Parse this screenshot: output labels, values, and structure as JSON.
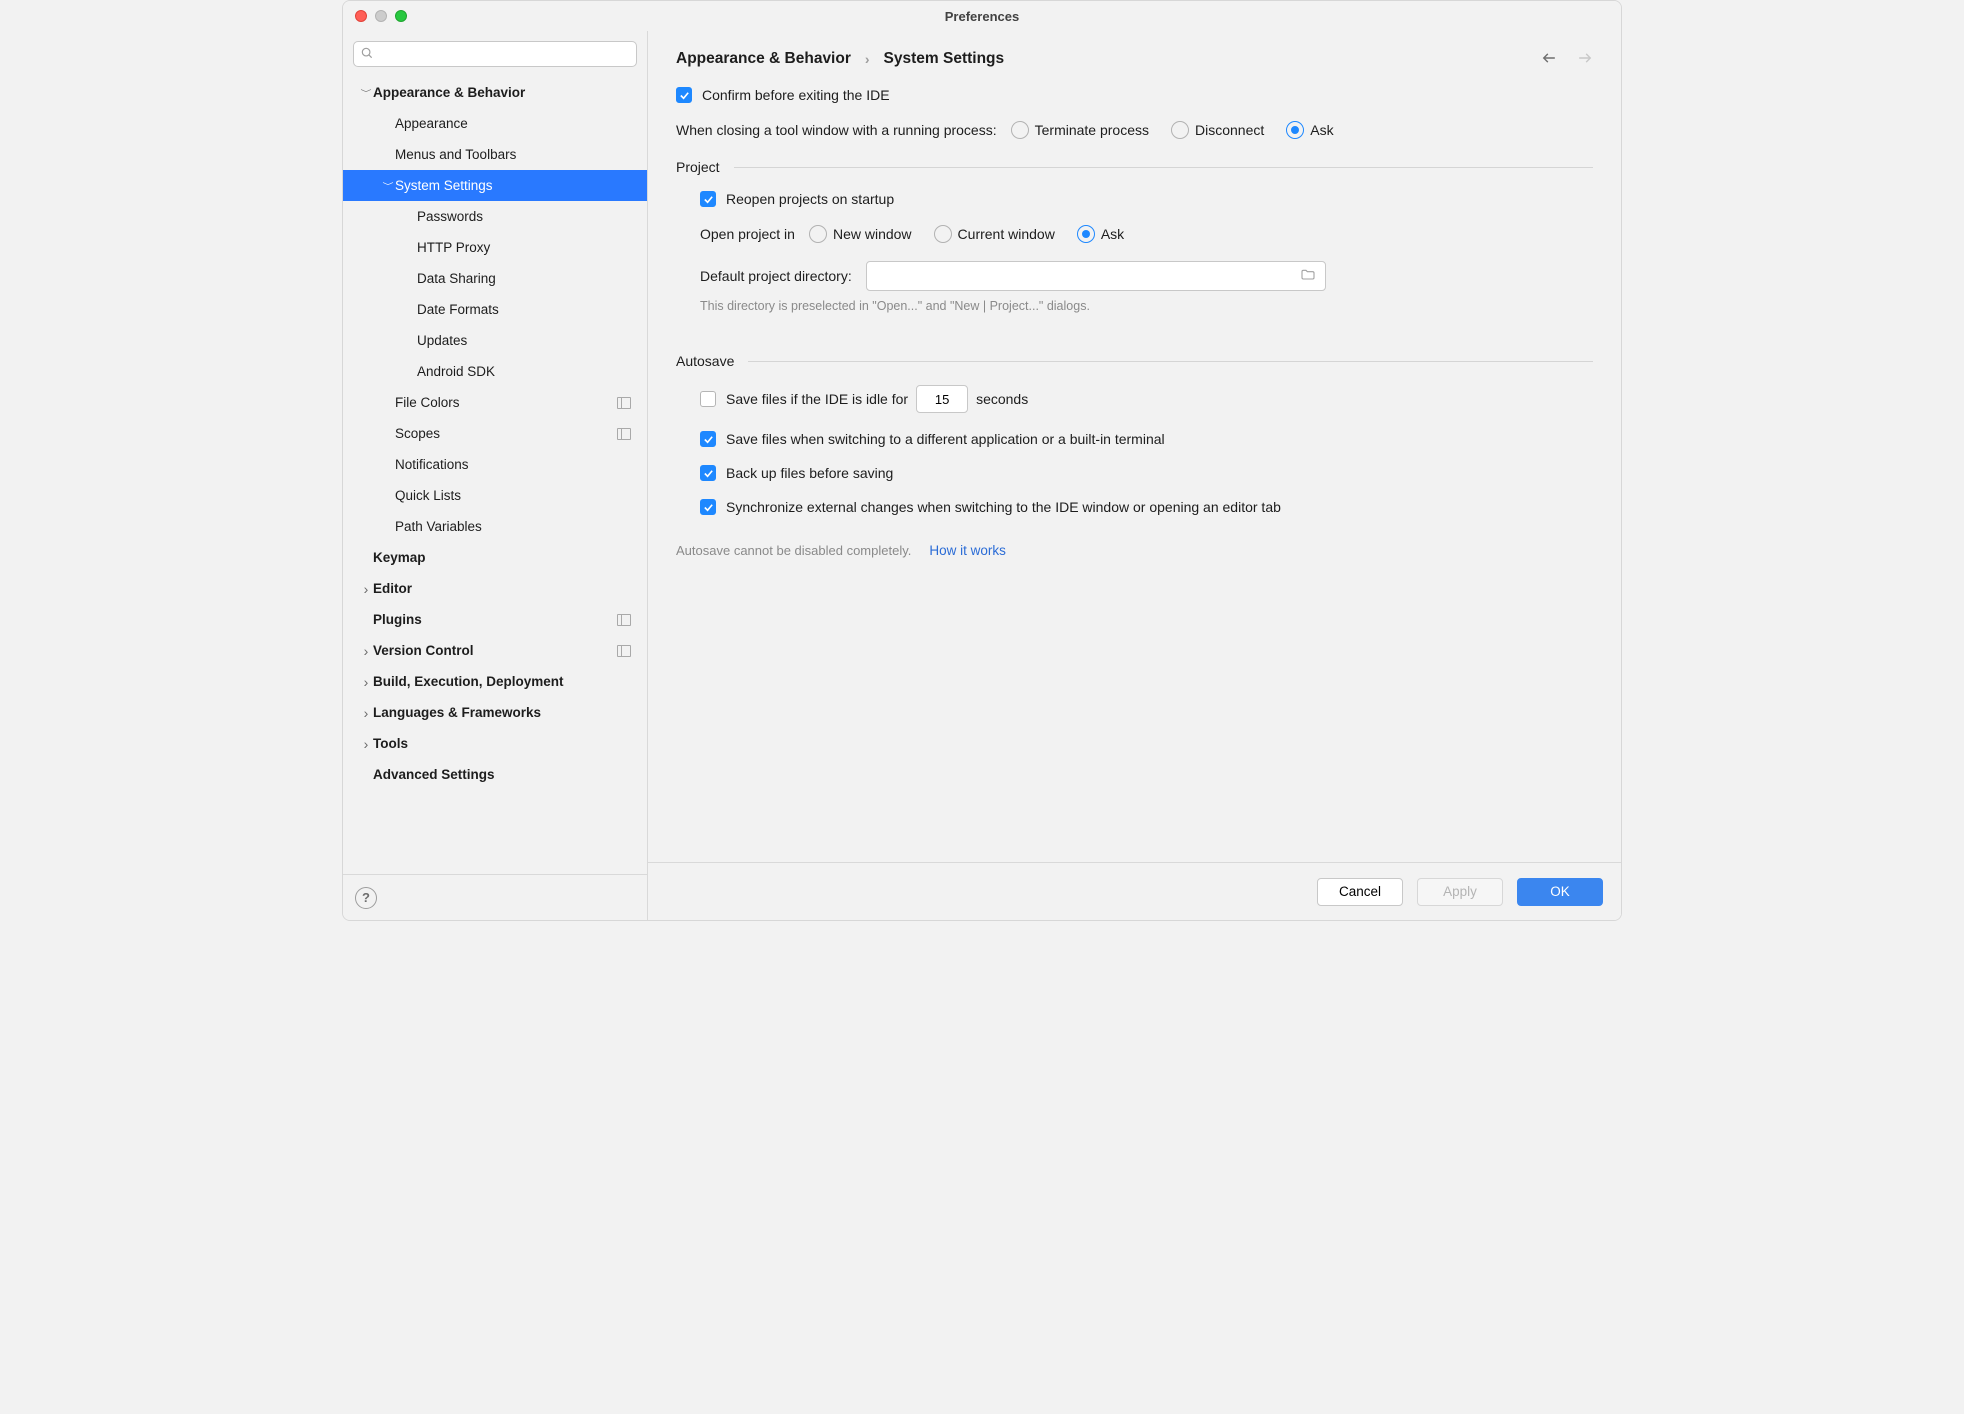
{
  "window": {
    "title": "Preferences"
  },
  "sidebar": {
    "search_placeholder": "",
    "items": [
      {
        "label": "Appearance & Behavior",
        "level": 0,
        "bold": true,
        "expanded": true,
        "has_children": true
      },
      {
        "label": "Appearance",
        "level": 1,
        "bold": false,
        "expanded": null,
        "has_children": false
      },
      {
        "label": "Menus and Toolbars",
        "level": 1,
        "bold": false,
        "expanded": null,
        "has_children": false
      },
      {
        "label": "System Settings",
        "level": 1,
        "bold": false,
        "expanded": true,
        "has_children": true,
        "selected": true
      },
      {
        "label": "Passwords",
        "level": 2,
        "bold": false,
        "expanded": null,
        "has_children": false
      },
      {
        "label": "HTTP Proxy",
        "level": 2,
        "bold": false,
        "expanded": null,
        "has_children": false
      },
      {
        "label": "Data Sharing",
        "level": 2,
        "bold": false,
        "expanded": null,
        "has_children": false
      },
      {
        "label": "Date Formats",
        "level": 2,
        "bold": false,
        "expanded": null,
        "has_children": false
      },
      {
        "label": "Updates",
        "level": 2,
        "bold": false,
        "expanded": null,
        "has_children": false
      },
      {
        "label": "Android SDK",
        "level": 2,
        "bold": false,
        "expanded": null,
        "has_children": false
      },
      {
        "label": "File Colors",
        "level": 1,
        "bold": false,
        "expanded": null,
        "has_children": false,
        "project_icon": true
      },
      {
        "label": "Scopes",
        "level": 1,
        "bold": false,
        "expanded": null,
        "has_children": false,
        "project_icon": true
      },
      {
        "label": "Notifications",
        "level": 1,
        "bold": false,
        "expanded": null,
        "has_children": false
      },
      {
        "label": "Quick Lists",
        "level": 1,
        "bold": false,
        "expanded": null,
        "has_children": false
      },
      {
        "label": "Path Variables",
        "level": 1,
        "bold": false,
        "expanded": null,
        "has_children": false
      },
      {
        "label": "Keymap",
        "level": 0,
        "bold": true,
        "expanded": null,
        "has_children": false
      },
      {
        "label": "Editor",
        "level": 0,
        "bold": true,
        "expanded": false,
        "has_children": true
      },
      {
        "label": "Plugins",
        "level": 0,
        "bold": true,
        "expanded": null,
        "has_children": false,
        "project_icon": true
      },
      {
        "label": "Version Control",
        "level": 0,
        "bold": true,
        "expanded": false,
        "has_children": true,
        "project_icon": true
      },
      {
        "label": "Build, Execution, Deployment",
        "level": 0,
        "bold": true,
        "expanded": false,
        "has_children": true
      },
      {
        "label": "Languages & Frameworks",
        "level": 0,
        "bold": true,
        "expanded": false,
        "has_children": true
      },
      {
        "label": "Tools",
        "level": 0,
        "bold": true,
        "expanded": false,
        "has_children": true
      },
      {
        "label": "Advanced Settings",
        "level": 0,
        "bold": true,
        "expanded": null,
        "has_children": false
      }
    ]
  },
  "breadcrumb": {
    "parent": "Appearance & Behavior",
    "current": "System Settings"
  },
  "settings": {
    "confirm_exit": {
      "label": "Confirm before exiting the IDE",
      "checked": true
    },
    "closing_process": {
      "label": "When closing a tool window with a running process:",
      "options": [
        "Terminate process",
        "Disconnect",
        "Ask"
      ],
      "selected": "Ask"
    },
    "sections": {
      "project": {
        "title": "Project"
      },
      "autosave": {
        "title": "Autosave"
      }
    },
    "reopen_projects": {
      "label": "Reopen projects on startup",
      "checked": true
    },
    "open_project_in": {
      "label": "Open project in",
      "options": [
        "New window",
        "Current window",
        "Ask"
      ],
      "selected": "Ask"
    },
    "default_dir": {
      "label": "Default project directory:",
      "value": "",
      "hint": "This directory is preselected in \"Open...\" and \"New | Project...\" dialogs."
    },
    "idle_save": {
      "label_before": "Save files if the IDE is idle for",
      "value": "15",
      "label_after": "seconds",
      "checked": false
    },
    "save_on_switch": {
      "label": "Save files when switching to a different application or a built-in terminal",
      "checked": true
    },
    "backup": {
      "label": "Back up files before saving",
      "checked": true
    },
    "sync_external": {
      "label": "Synchronize external changes when switching to the IDE window or opening an editor tab",
      "checked": true
    },
    "autosave_note": {
      "text": "Autosave cannot be disabled completely.",
      "link": "How it works"
    }
  },
  "footer": {
    "cancel": "Cancel",
    "apply": "Apply",
    "ok": "OK"
  }
}
